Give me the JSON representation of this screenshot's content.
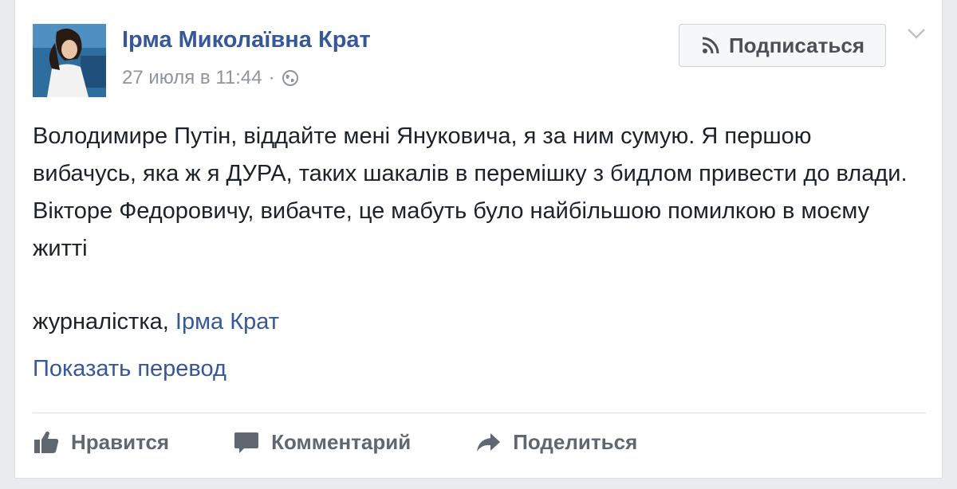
{
  "post": {
    "author": "Ірма Миколаївна Крат",
    "timestamp": "27 июля в 11:44",
    "separator": "·",
    "privacy_icon": "globe-icon",
    "subscribe_label": "Подписаться",
    "paragraphs": [
      "Володимире Путін, віддайте мені Януковича, я за ним сумую. Я першою вибачусь, яка ж я ДУРА, таких шакалів в перемішку з бидлом привести до влади.",
      "Вікторе Федоровичу, вибачте, це мабуть було найбільшою помилкою в моєму житті"
    ],
    "signature_prefix": "журналістка, ",
    "signature_link": "Ірма Крат",
    "translate_label": "Показать перевод"
  },
  "actions": {
    "like_label": "Нравится",
    "comment_label": "Комментарий",
    "share_label": "Поделиться"
  },
  "colors": {
    "link": "#365899",
    "text": "#1d2129",
    "muted": "#90949c",
    "action": "#606770"
  }
}
